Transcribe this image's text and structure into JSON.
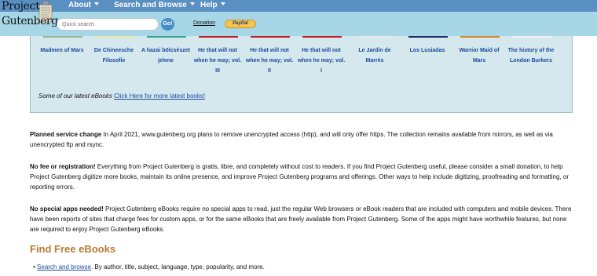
{
  "header": {
    "logo": {
      "line1": "Project",
      "line2": "Gutenberg"
    },
    "menu": [
      {
        "label": "About"
      },
      {
        "label": "Search and Browse"
      },
      {
        "label": "Help"
      }
    ],
    "search": {
      "placeholder": "Quick search",
      "go_label": "Go!"
    },
    "donation_label": "Donation",
    "paypal_label": "PayPal"
  },
  "latest": {
    "books": [
      {
        "title": "Madmen of Mars"
      },
      {
        "title": "De Chineesche Filosofie"
      },
      {
        "title": "A hazai bölcsészet jelene"
      },
      {
        "title": "He that will not when he may; vol. III"
      },
      {
        "title": "He that will not when he may; vol. II"
      },
      {
        "title": "He that will not when he may; vol. I"
      },
      {
        "title": "Le Jardin de Marrès"
      },
      {
        "title": "Los Lusiadas"
      },
      {
        "title": "Warrior Maid of Mars"
      },
      {
        "title": "The history of the London Burkers"
      }
    ],
    "caption": "Some of our latest eBooks",
    "link_label": "Click Here for more latest books!"
  },
  "paragraphs": {
    "planned_label": "Planned service change",
    "planned_text": " In April 2021, www.gutenberg.org plans to remove unencrypted access (http), and will only offer https. The collection remains available from mirrors, as well as via unencrypted ftp and rsync.",
    "nofee_label": "No fee or registration!",
    "nofee_text": " Everything from Project Gutenberg is gratis, libre, and completely without cost to readers. If you find Project Gutenberg useful, please consider a small donation, to help Project Gutenberg digitize more books, maintain its online presence, and improve Project Gutenberg programs and offerings. Other ways to help include digitizing, proofreading and formatting, or reporting errors.",
    "noapps_label": "No special apps needed!",
    "noapps_text": " Project Gutenberg eBooks require no special apps to read, just the regular Web browsers or eBook readers that are included with computers and mobile devices. There have been reports of sites that charge fees for custom apps, or for the same eBooks that are freely available from Project Gutenberg. Some of the apps might have worthwhile features, but none are required to enjoy Project Gutenberg eBooks."
  },
  "find": {
    "heading": "Find Free eBooks",
    "bullet_link": "Search and browse",
    "bullet_text": ". By author, title, subject, language, type, popularity, and more."
  },
  "colors": {
    "menubar": "#5a8fc2",
    "header_bg": "#a7d7e6",
    "panel_bg": "#d4e8ee",
    "link": "#1d4a9a",
    "heading": "#b97a2e"
  }
}
